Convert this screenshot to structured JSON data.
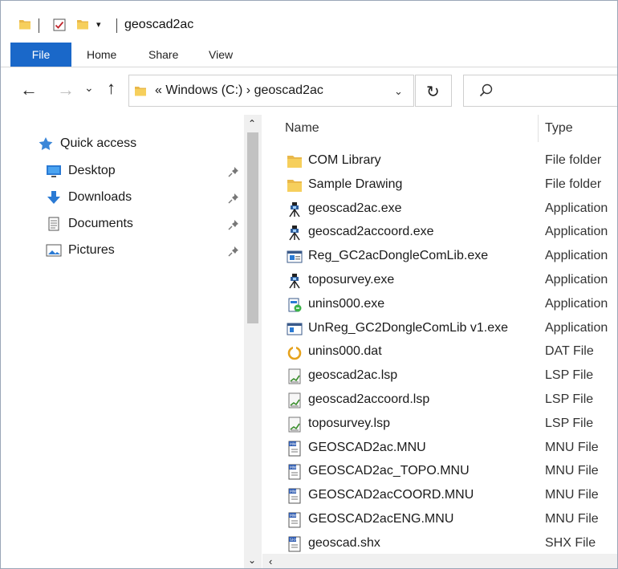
{
  "window": {
    "title": "geoscad2ac"
  },
  "quick_access_toolbar": {
    "dropdown_glyph": "▾",
    "icons": [
      "folder-icon",
      "properties-check-icon",
      "new-folder-icon"
    ]
  },
  "ribbon": {
    "tabs": [
      {
        "label": "File",
        "active": true
      },
      {
        "label": "Home"
      },
      {
        "label": "Share"
      },
      {
        "label": "View"
      }
    ],
    "accent_color": "#1a68c9"
  },
  "navigation": {
    "back_glyph": "←",
    "forward_glyph": "→",
    "recent_glyph": "⌄",
    "up_glyph": "↑",
    "address_text": "«  Windows (C:)  ›  geoscad2ac",
    "address_dropdown_glyph": "⌄",
    "refresh_glyph": "↻",
    "search_placeholder": ""
  },
  "nav_pane": {
    "items": [
      {
        "label": "Quick access",
        "icon": "star-icon",
        "pinned": false
      },
      {
        "label": "Desktop",
        "icon": "desktop-icon",
        "pinned": true
      },
      {
        "label": "Downloads",
        "icon": "download-arrow-icon",
        "pinned": true
      },
      {
        "label": "Documents",
        "icon": "documents-icon",
        "pinned": true
      },
      {
        "label": "Pictures",
        "icon": "pictures-icon",
        "pinned": true
      }
    ],
    "scroll_up_glyph": "⌃",
    "scroll_down_glyph": "⌄"
  },
  "file_list": {
    "columns": {
      "name": "Name",
      "type": "Type"
    },
    "rows": [
      {
        "name": "COM Library",
        "type": "File folder",
        "icon": "folder-icon"
      },
      {
        "name": "Sample Drawing",
        "type": "File folder",
        "icon": "folder-icon"
      },
      {
        "name": "geoscad2ac.exe",
        "type": "Application",
        "icon": "survey-instrument-icon"
      },
      {
        "name": "geoscad2accoord.exe",
        "type": "Application",
        "icon": "survey-instrument-icon"
      },
      {
        "name": "Reg_GC2acDongleComLib.exe",
        "type": "Application",
        "icon": "register-app-icon"
      },
      {
        "name": "toposurvey.exe",
        "type": "Application",
        "icon": "survey-instrument-icon"
      },
      {
        "name": "unins000.exe",
        "type": "Application",
        "icon": "uninstaller-icon"
      },
      {
        "name": "UnReg_GC2DongleComLib v1.exe",
        "type": "Application",
        "icon": "app-window-icon"
      },
      {
        "name": "unins000.dat",
        "type": "DAT File",
        "icon": "dat-ring-icon"
      },
      {
        "name": "geoscad2ac.lsp",
        "type": "LSP File",
        "icon": "lsp-file-icon"
      },
      {
        "name": "geoscad2accoord.lsp",
        "type": "LSP File",
        "icon": "lsp-file-icon"
      },
      {
        "name": "toposurvey.lsp",
        "type": "LSP File",
        "icon": "lsp-file-icon"
      },
      {
        "name": "GEOSCAD2ac.MNU",
        "type": "MNU File",
        "icon": "mnu-file-icon"
      },
      {
        "name": "GEOSCAD2ac_TOPO.MNU",
        "type": "MNU File",
        "icon": "mnu-file-icon"
      },
      {
        "name": "GEOSCAD2acCOORD.MNU",
        "type": "MNU File",
        "icon": "mnu-file-icon"
      },
      {
        "name": "GEOSCAD2acENG.MNU",
        "type": "MNU File",
        "icon": "mnu-file-icon"
      },
      {
        "name": "geoscad.shx",
        "type": "SHX File",
        "icon": "shx-file-icon"
      }
    ],
    "scroll_left_glyph": "‹"
  }
}
